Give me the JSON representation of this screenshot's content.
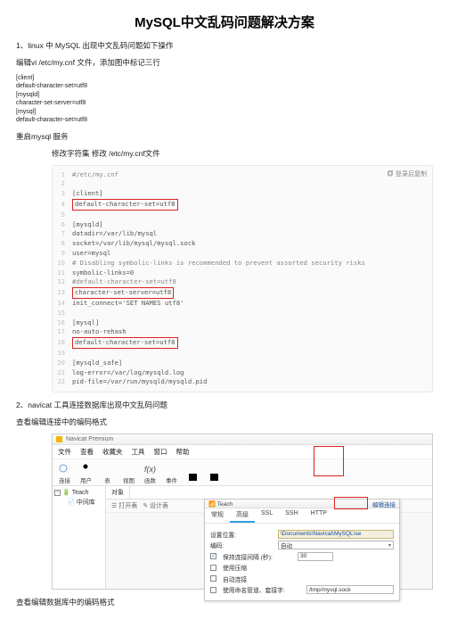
{
  "title": "MySQL中文乱码问题解决方案",
  "p1": "1、linux 中 MySQL 出现中文乱码问题如下操作",
  "p2": "编辑vi /etc/my.cnf 文件，添加图中标记三行",
  "code1": [
    "[client]",
    "default-character-set=utf8",
    "[mysqld]",
    "character-set-server=utf8",
    "[mysql]",
    "default-character-set=utf8"
  ],
  "p3": "重启mysql 服务",
  "p4": "修改字符集 修改 /etc/my.cnf文件",
  "copy": "登录后复制",
  "cnf": [
    {
      "n": 1,
      "t": "#/etc/my.cnf",
      "cls": "comment"
    },
    {
      "n": 2,
      "t": ""
    },
    {
      "n": 3,
      "t": "[client]"
    },
    {
      "n": 4,
      "t": "default-character-set=utf8",
      "box": true
    },
    {
      "n": 5,
      "t": ""
    },
    {
      "n": 6,
      "t": "[mysqld]"
    },
    {
      "n": 7,
      "t": "datadir=/var/lib/mysql"
    },
    {
      "n": 8,
      "t": "socket=/var/lib/mysql/mysql.sock"
    },
    {
      "n": 9,
      "t": "user=mysql"
    },
    {
      "n": 10,
      "t": "# Disabling symbolic-links is recommended to prevent assorted security risks",
      "cls": "comment"
    },
    {
      "n": 11,
      "t": "symbolic-links=0"
    },
    {
      "n": 12,
      "t": "#default-character-set=utf8",
      "cls": "comment"
    },
    {
      "n": 13,
      "t": "character-set-server=utf8",
      "box": true
    },
    {
      "n": 14,
      "t": "init_connect='SET NAMES utf8'"
    },
    {
      "n": 15,
      "t": ""
    },
    {
      "n": 16,
      "t": "[mysql]"
    },
    {
      "n": 17,
      "t": "no-auto-rehash"
    },
    {
      "n": 18,
      "t": "default-character-set=utf8",
      "box": true
    },
    {
      "n": 19,
      "t": ""
    },
    {
      "n": 20,
      "t": "[mysqld_safe]"
    },
    {
      "n": 21,
      "t": "log-error=/var/log/mysqld.log"
    },
    {
      "n": 22,
      "t": "pid-file=/var/run/mysqld/mysqld.pid"
    }
  ],
  "p5": "2、navicat 工具连接数据库出现中文乱码问题",
  "p6": "查看编辑连接中的编码格式",
  "nav": {
    "app": "Navicat Premium",
    "menus": [
      "文件",
      "查看",
      "收藏夹",
      "工具",
      "窗口",
      "帮助"
    ],
    "toolbar": [
      {
        "label": "连接",
        "color": "#6ea0d6"
      },
      {
        "label": "用户",
        "color": "#4a4a4a"
      },
      {
        "label": "表",
        "color": "#d6a94a"
      },
      {
        "label": "视图",
        "color": "#d07070"
      },
      {
        "label": "函数",
        "color": "#4a4a4a"
      },
      {
        "label": "事件",
        "color": "#5aa05a"
      }
    ],
    "tree": {
      "root": "Teach",
      "leaf": "中间库"
    },
    "obj_tab": "对象",
    "objbar": {
      "open": "打开表",
      "design": "设计表"
    },
    "extra": "编辑连接",
    "dialog": {
      "title_hint": "Teach",
      "tabs": [
        "常规",
        "高级",
        "SSL",
        "SSH",
        "HTTP"
      ],
      "fields": {
        "loc_label": "设置位置:",
        "loc_value": "\\Documents\\Navicat\\MySQL\\se",
        "enc_label": "编码:",
        "enc_value": "自动",
        "keep_label": "保持连接间隔 (秒):",
        "keep_value": "30",
        "zip_label": "使用压缩",
        "auto_label": "自动连接",
        "sock_label": "使用命名管道、套接字:",
        "sock_value": "/tmp/mysql.sock"
      }
    }
  },
  "p7": "查看编辑数据库中的编码格式"
}
